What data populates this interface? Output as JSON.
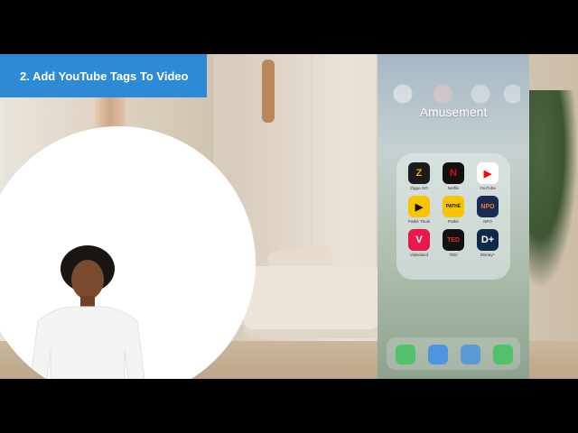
{
  "banner": {
    "title": "2. Add YouTube Tags To Video"
  },
  "phone": {
    "folder_title": "Amusement",
    "apps": [
      {
        "label": "Ziggo GO",
        "glyph": "Z",
        "color": "#1b1b1b",
        "accent": "#f2a51a"
      },
      {
        "label": "Netflix",
        "glyph": "N",
        "color": "#111111",
        "accent": "#e50914"
      },
      {
        "label": "YouTube",
        "glyph": "▶",
        "color": "#ffffff",
        "accent": "#ff0000"
      },
      {
        "label": "Pathé Thuis",
        "glyph": "▶",
        "color": "#f8c400",
        "accent": "#111111"
      },
      {
        "label": "Pathé",
        "glyph": "PATHÉ",
        "color": "#f8c400",
        "accent": "#111111"
      },
      {
        "label": "NPO",
        "glyph": "NPO",
        "color": "#1a2b52",
        "accent": "#f47b20"
      },
      {
        "label": "Videoland",
        "glyph": "V",
        "color": "#e8194a",
        "accent": "#ffffff"
      },
      {
        "label": "TED",
        "glyph": "TED",
        "color": "#111111",
        "accent": "#e62b1e"
      },
      {
        "label": "Disney+",
        "glyph": "D+",
        "color": "#0d2a4a",
        "accent": "#ffffff"
      }
    ]
  }
}
